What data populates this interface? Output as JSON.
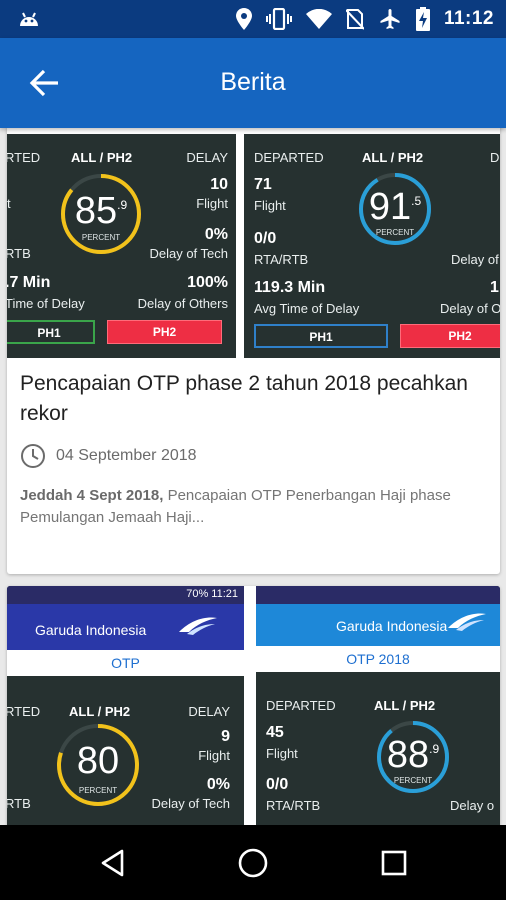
{
  "status_bar": {
    "time": "11:12",
    "icons": [
      "android-icon",
      "location-icon",
      "vibrate-icon",
      "wifi-icon",
      "no-sim-icon",
      "airplane-icon",
      "battery-charging-icon"
    ]
  },
  "app_bar": {
    "title": "Berita"
  },
  "article1": {
    "headline": "Pencapaian OTP phase 2 tahun 2018 pecahkan rekor",
    "date": "04 September 2018",
    "excerpt_bold": "Jeddah 4 Sept 2018,",
    "excerpt_rest": " Pencapaian OTP Penerbangan Haji phase Pemulangan Jemaah Haji...",
    "image_left": {
      "departed": "RTED",
      "title": "ALL / PH2",
      "delay": "DELAY",
      "flight_count": "10",
      "flight_label": "Flight",
      "left_small": "t",
      "gauge_value": "85",
      "gauge_decimal": ".9",
      "gauge_unit": "PERCENT",
      "rta_label": "RTB",
      "tech_value": "0%",
      "tech_label": "Delay of Tech",
      "avg_value": ".7 Min",
      "avg_label": "Time of Delay",
      "others_value": "100%",
      "others_label": "Delay of Others",
      "ph1": "PH1",
      "ph2": "PH2"
    },
    "image_right": {
      "departed": "DEPARTED",
      "title": "ALL / PH2",
      "delay": "D",
      "flight_count": "71",
      "flight_label": "Flight",
      "gauge_value": "91",
      "gauge_decimal": ".5",
      "gauge_unit": "PERCENT",
      "rta_value": "0/0",
      "rta_label": "RTA/RTB",
      "tech_label": "Delay of",
      "avg_value": "119.3 Min",
      "avg_label": "Avg Time of Delay",
      "others_value": "1",
      "others_label": "Delay of O",
      "ph1": "PH1",
      "ph2": "PH2"
    }
  },
  "article2": {
    "image_left": {
      "status_text": "70% 11:21",
      "brand": "Garuda Indonesia",
      "otp": "OTP",
      "departed": "RTED",
      "title": "ALL / PH2",
      "delay": "DELAY",
      "flight_count": "9",
      "flight_label": "Flight",
      "gauge_value": "80",
      "gauge_unit": "PERCENT",
      "rta_label": "RTB",
      "tech_value": "0%",
      "tech_label": "Delay of Tech"
    },
    "image_right": {
      "brand": "Garuda Indonesia",
      "otp": "OTP  2018",
      "departed": "DEPARTED",
      "title": "ALL / PH2",
      "flight_count": "45",
      "flight_label": "Flight",
      "gauge_value": "88",
      "gauge_decimal": ".9",
      "gauge_unit": "PERCENT",
      "rta_value": "0/0",
      "rta_label": "RTA/RTB",
      "tech_label": "Delay o"
    }
  },
  "nav_bar": {
    "buttons": [
      "back-triangle-icon",
      "home-circle-icon",
      "recents-square-icon"
    ]
  },
  "colors": {
    "status_bar": "#0b3b80",
    "app_bar": "#1565c0",
    "panel": "#263130",
    "gauge_yellow": "#f2c21b",
    "gauge_blue": "#2a9fd8",
    "ph_red": "#ee2e44",
    "ph_green": "#3aa54a"
  }
}
